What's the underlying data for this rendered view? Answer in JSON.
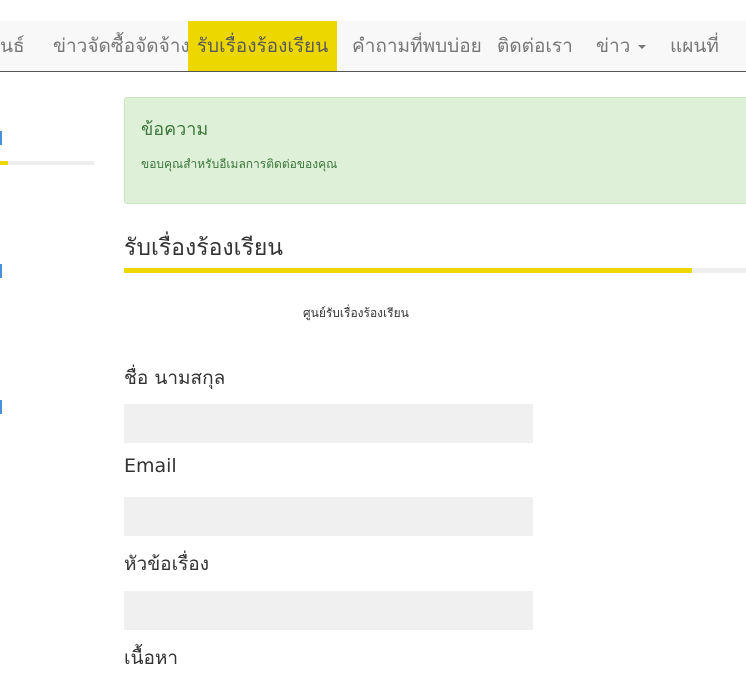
{
  "nav": {
    "items": [
      {
        "label": "นธ์"
      },
      {
        "label": "ข่าวจัดซื้อจัดจ้าง"
      },
      {
        "label": "รับเรื่องร้องเรียน",
        "active": true
      },
      {
        "label": "คำถามที่พบบ่อย"
      },
      {
        "label": "ติดต่อเรา"
      },
      {
        "label": "ข่าว",
        "dropdown": true
      },
      {
        "label": "แผนที่"
      }
    ]
  },
  "alert": {
    "title": "ข้อความ",
    "message": "ขอบคุณสำหรับอีเมลการติดต่อของคุณ"
  },
  "page": {
    "title": "รับเรื่องร้องเรียน",
    "subtitle": "ศูนย์รับเรื่องร้องเรียน"
  },
  "form": {
    "name_label": "ชื่อ นามสกุล",
    "name_value": "",
    "email_label": "Email",
    "email_value": "",
    "subject_label": "หัวข้อเรื่อง",
    "subject_value": "",
    "content_label": "เนื้อหา"
  },
  "colors": {
    "accent": "#ecd800",
    "alert_bg": "#dff0d8",
    "alert_text": "#3c763d",
    "field_bg": "#f0f0f0"
  }
}
